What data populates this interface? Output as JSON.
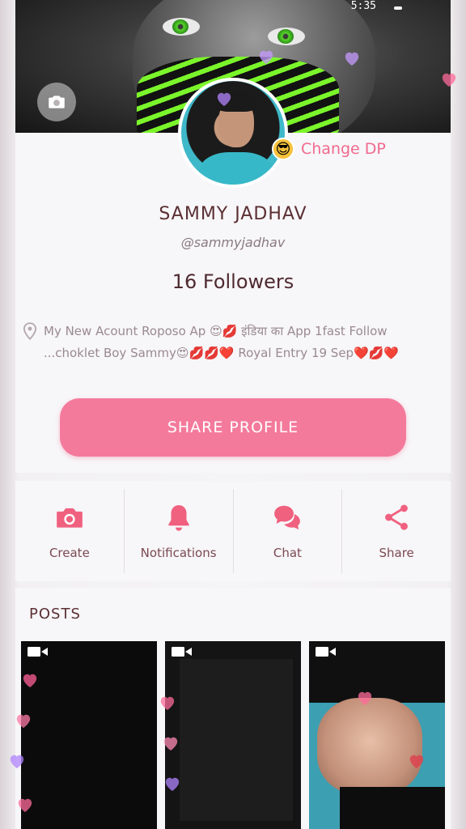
{
  "status": {
    "time": "5:35"
  },
  "profile": {
    "change_dp_label": "Change DP",
    "change_dp_emoji": "😎",
    "name": "SAMMY JADHAV",
    "handle": "@sammyjadhav",
    "followers": "16 Followers",
    "bio": "My New Acount Roposo Ap 😍💋 इंडिया का App 1fast Follow ...choklet Boy Sammy😍💋💋❤️ Royal Entry 19 Sep❤️💋❤️",
    "share_label": "SHARE PROFILE"
  },
  "actions": [
    {
      "label": "Create",
      "icon": "camera-icon"
    },
    {
      "label": "Notifications",
      "icon": "bell-icon"
    },
    {
      "label": "Chat",
      "icon": "chat-bubbles-icon"
    },
    {
      "label": "Share",
      "icon": "share-icon"
    }
  ],
  "posts": {
    "title": "POSTS",
    "items": [
      {
        "type": "video",
        "icon": "video-camera-icon"
      },
      {
        "type": "video",
        "icon": "video-camera-icon"
      },
      {
        "type": "video",
        "icon": "video-camera-icon"
      }
    ]
  },
  "colors": {
    "accent": "#f47a9c",
    "name_text": "#5a2f33",
    "icon_pink": "#f0607f"
  }
}
